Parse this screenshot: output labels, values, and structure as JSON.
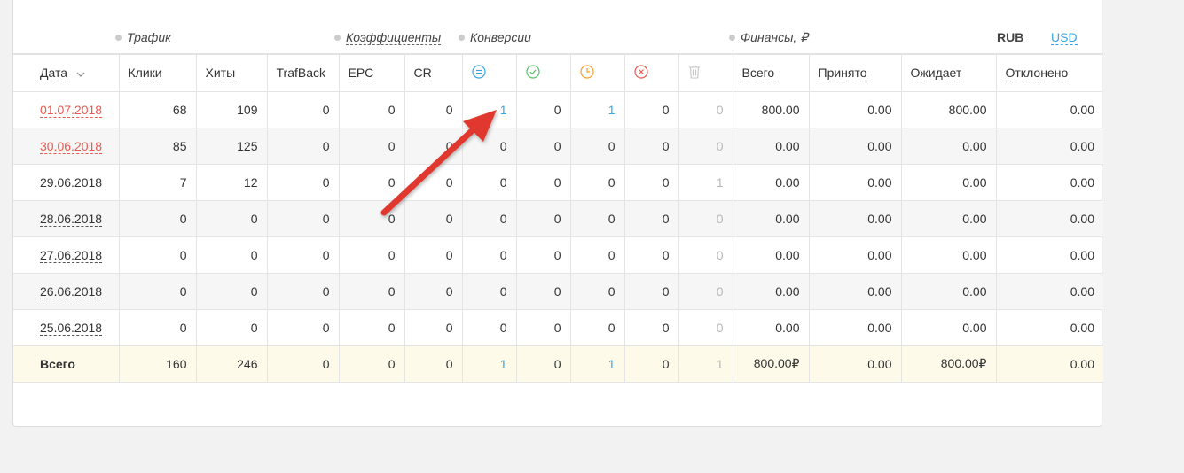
{
  "groups": {
    "traffic": "Трафик",
    "coefficients": "Коэффициенты",
    "conversions": "Конверсии",
    "finance": "Финансы, ₽"
  },
  "currency": {
    "rub": "RUB",
    "usd": "USD"
  },
  "headers": {
    "date": "Дата",
    "clicks": "Клики",
    "hits": "Хиты",
    "trafback": "TrafBack",
    "epc": "EPC",
    "cr": "CR",
    "total": "Всего",
    "accepted": "Принято",
    "pending": "Ожидает",
    "rejected": "Отклонено"
  },
  "conversion_icons": [
    "all-conversions-icon",
    "approved-check-icon",
    "pending-clock-icon",
    "rejected-x-icon",
    "trash-icon"
  ],
  "colors": {
    "accent_blue": "#3aa3e3",
    "red_date": "#e95a52",
    "approved": "#5cbf6a",
    "pending": "#f0a030",
    "rejected": "#e95a52",
    "arrow": "#e0382d"
  },
  "rows": [
    {
      "date": "01.07.2018",
      "clicks": "68",
      "hits": "109",
      "trafback": "0",
      "epc": "0",
      "cr": "0",
      "c_all": "1",
      "c_ok": "0",
      "c_wait": "1",
      "c_rej": "0",
      "c_del": "0",
      "total": "800.00",
      "accepted": "0.00",
      "pending": "800.00",
      "rejected": "0.00"
    },
    {
      "date": "30.06.2018",
      "clicks": "85",
      "hits": "125",
      "trafback": "0",
      "epc": "0",
      "cr": "0",
      "c_all": "0",
      "c_ok": "0",
      "c_wait": "0",
      "c_rej": "0",
      "c_del": "0",
      "total": "0.00",
      "accepted": "0.00",
      "pending": "0.00",
      "rejected": "0.00"
    },
    {
      "date": "29.06.2018",
      "clicks": "7",
      "hits": "12",
      "trafback": "0",
      "epc": "0",
      "cr": "0",
      "c_all": "0",
      "c_ok": "0",
      "c_wait": "0",
      "c_rej": "0",
      "c_del": "1",
      "total": "0.00",
      "accepted": "0.00",
      "pending": "0.00",
      "rejected": "0.00"
    },
    {
      "date": "28.06.2018",
      "clicks": "0",
      "hits": "0",
      "trafback": "0",
      "epc": "0",
      "cr": "0",
      "c_all": "0",
      "c_ok": "0",
      "c_wait": "0",
      "c_rej": "0",
      "c_del": "0",
      "total": "0.00",
      "accepted": "0.00",
      "pending": "0.00",
      "rejected": "0.00"
    },
    {
      "date": "27.06.2018",
      "clicks": "0",
      "hits": "0",
      "trafback": "0",
      "epc": "0",
      "cr": "0",
      "c_all": "0",
      "c_ok": "0",
      "c_wait": "0",
      "c_rej": "0",
      "c_del": "0",
      "total": "0.00",
      "accepted": "0.00",
      "pending": "0.00",
      "rejected": "0.00"
    },
    {
      "date": "26.06.2018",
      "clicks": "0",
      "hits": "0",
      "trafback": "0",
      "epc": "0",
      "cr": "0",
      "c_all": "0",
      "c_ok": "0",
      "c_wait": "0",
      "c_rej": "0",
      "c_del": "0",
      "total": "0.00",
      "accepted": "0.00",
      "pending": "0.00",
      "rejected": "0.00"
    },
    {
      "date": "25.06.2018",
      "clicks": "0",
      "hits": "0",
      "trafback": "0",
      "epc": "0",
      "cr": "0",
      "c_all": "0",
      "c_ok": "0",
      "c_wait": "0",
      "c_rej": "0",
      "c_del": "0",
      "total": "0.00",
      "accepted": "0.00",
      "pending": "0.00",
      "rejected": "0.00"
    }
  ],
  "totals": {
    "label": "Всего",
    "clicks": "160",
    "hits": "246",
    "trafback": "0",
    "epc": "0",
    "cr": "0",
    "c_all": "1",
    "c_ok": "0",
    "c_wait": "1",
    "c_rej": "0",
    "c_del": "1",
    "total": "800.00₽",
    "accepted": "0.00",
    "pending": "800.00₽",
    "rejected": "0.00"
  }
}
